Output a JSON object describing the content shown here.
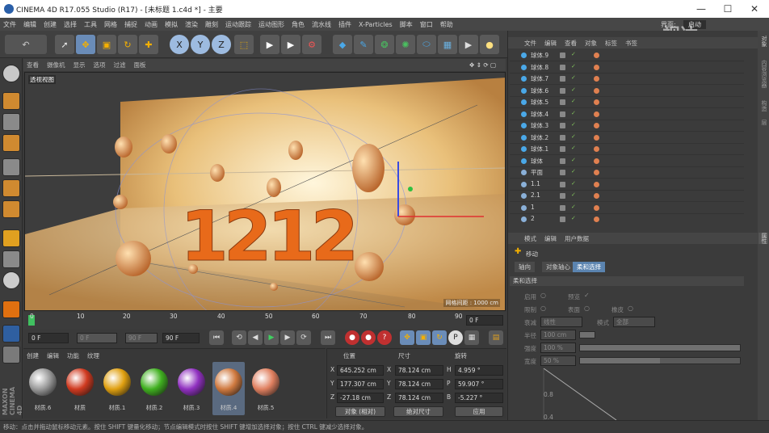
{
  "window": {
    "title": "CINEMA 4D R17.055 Studio (R17) - [未标题 1.c4d *] - 主要",
    "minimize": "—",
    "maximize": "☐",
    "close": "✕"
  },
  "menu": [
    "文件",
    "编辑",
    "创建",
    "选择",
    "工具",
    "网格",
    "捕捉",
    "动画",
    "模拟",
    "渲染",
    "雕刻",
    "运动跟踪",
    "运动图形",
    "角色",
    "流水线",
    "插件",
    "X-Particles",
    "脚本",
    "窗口",
    "帮助"
  ],
  "layout_label": "界面:",
  "layout_value": "启动",
  "watermark": "视达",
  "viewport": {
    "menu": [
      "查看",
      "摄像机",
      "显示",
      "选项",
      "过滤",
      "面板"
    ],
    "label": "透视视图",
    "grid_spacing": "网格间距 : 1000 cm",
    "text_numbers": "1212"
  },
  "timeline": {
    "ticks": [
      "0",
      "10",
      "20",
      "30",
      "40",
      "50",
      "60",
      "70",
      "80",
      "90"
    ],
    "end_field": "0 F"
  },
  "playbar": {
    "start": "0 F",
    "range_start": "0 F",
    "range_end": "90 F",
    "end": "90 F"
  },
  "materials": {
    "menu": [
      "创建",
      "编辑",
      "功能",
      "纹理"
    ],
    "items": [
      {
        "name": "材质.6",
        "color": "#9a9a9a"
      },
      {
        "name": "材质",
        "color": "#d03a20"
      },
      {
        "name": "材质.1",
        "color": "#e0a010"
      },
      {
        "name": "材质.2",
        "color": "#40b020"
      },
      {
        "name": "材质.3",
        "color": "#9030c0"
      },
      {
        "name": "材质.4",
        "color": "#d07a40"
      },
      {
        "name": "材质.5",
        "color": "#e08060"
      }
    ]
  },
  "coords": {
    "headers": [
      "位置",
      "尺寸",
      "旋转"
    ],
    "rows": [
      {
        "axis": "X",
        "pos": "645.252 cm",
        "saxis": "X",
        "size": "78.124 cm",
        "raxis": "H",
        "rot": "4.959 °"
      },
      {
        "axis": "Y",
        "pos": "177.307 cm",
        "saxis": "Y",
        "size": "78.124 cm",
        "raxis": "P",
        "rot": "59.907 °"
      },
      {
        "axis": "Z",
        "pos": "-27.18 cm",
        "saxis": "Z",
        "size": "78.124 cm",
        "raxis": "B",
        "rot": "-5.227 °"
      }
    ],
    "mode1": "对象 (相对)",
    "mode2": "绝对尺寸",
    "apply": "应用"
  },
  "objects": {
    "menu": [
      "文件",
      "编辑",
      "查看",
      "对象",
      "标签",
      "书签"
    ],
    "rows": [
      {
        "name": "球体.9"
      },
      {
        "name": "球体.8"
      },
      {
        "name": "球体.7"
      },
      {
        "name": "球体.6"
      },
      {
        "name": "球体.5"
      },
      {
        "name": "球体.4"
      },
      {
        "name": "球体.3"
      },
      {
        "name": "球体.2"
      },
      {
        "name": "球体.1"
      },
      {
        "name": "球体"
      },
      {
        "name": "平面"
      },
      {
        "name": "1.1"
      },
      {
        "name": "2.1"
      },
      {
        "name": "1"
      },
      {
        "name": "2"
      }
    ]
  },
  "attributes": {
    "menu": [
      "模式",
      "编辑",
      "用户数据"
    ],
    "title": "移动",
    "tabs": [
      "轴向",
      "对象轴心",
      "柔和选择"
    ],
    "section": "柔和选择",
    "enable": "启用",
    "preview": "预览",
    "restrict": "限制",
    "surface": "表面",
    "rubber": "橡皮",
    "mode_label": "模式",
    "mode_value": "全部",
    "type_label": "衰减",
    "type_value": "线性",
    "radius_label": "半径",
    "radius_value": "100 cm",
    "strength_label": "强度",
    "strength_value": "100 %",
    "width_label": "宽度",
    "width_value": "50 %",
    "graph_tick1": "0.8",
    "graph_tick2": "0.4"
  },
  "side_tabs": [
    "对象",
    "内容浏览器",
    "构造",
    "层"
  ],
  "side_tab_attr": "属性",
  "status": "移动：点击并拖动鼠标移动元素。按住 SHIFT 键量化移动；节点编辑模式时按住 SHIFT 键增加选择对象；按住 CTRL 键减少选择对象。",
  "maxon": "MAXON CINEMA 4D"
}
